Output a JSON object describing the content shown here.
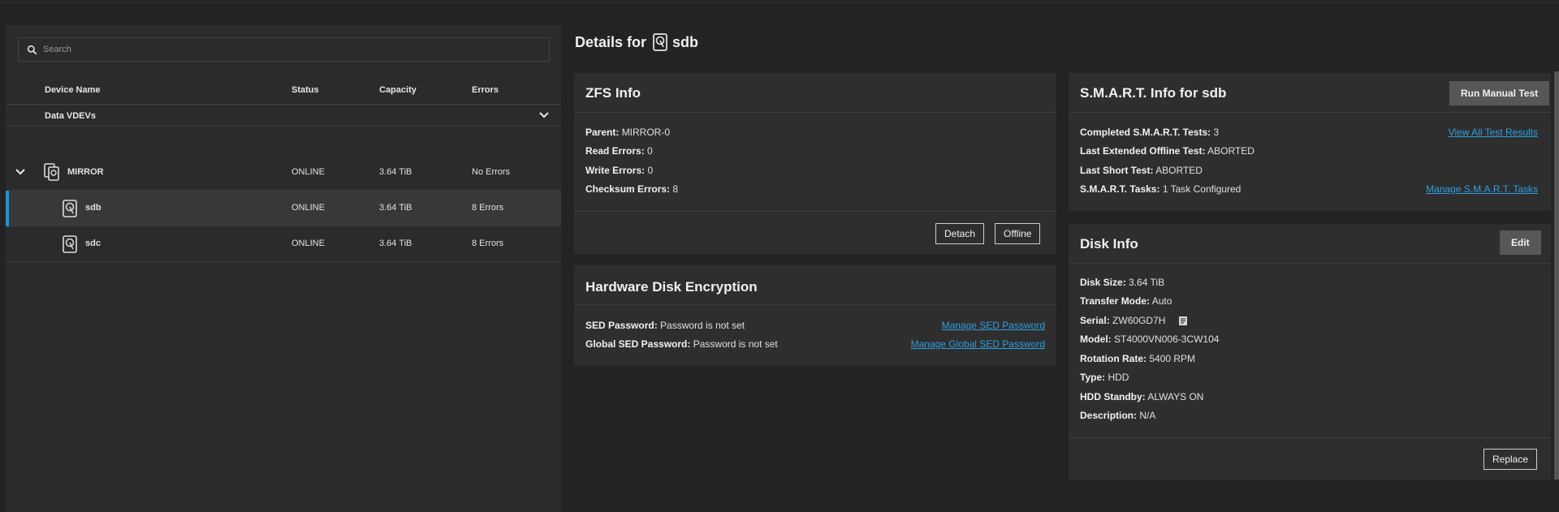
{
  "search": {
    "placeholder": "Search"
  },
  "table": {
    "headers": {
      "name": "Device Name",
      "status": "Status",
      "capacity": "Capacity",
      "errors": "Errors"
    },
    "group_label": "Data VDEVs",
    "rows": [
      {
        "name": "MIRROR",
        "status": "ONLINE",
        "capacity": "3.64 TiB",
        "errors": "No Errors"
      },
      {
        "name": "sdb",
        "status": "ONLINE",
        "capacity": "3.64 TiB",
        "errors": "8 Errors"
      },
      {
        "name": "sdc",
        "status": "ONLINE",
        "capacity": "3.64 TiB",
        "errors": "8 Errors"
      }
    ]
  },
  "details": {
    "prefix": "Details for",
    "disk": "sdb"
  },
  "zfs": {
    "title": "ZFS Info",
    "parent_label": "Parent:",
    "parent": "MIRROR-0",
    "read_label": "Read Errors:",
    "read": "0",
    "write_label": "Write Errors:",
    "write": "0",
    "checksum_label": "Checksum Errors:",
    "checksum": "8",
    "detach": "Detach",
    "offline": "Offline"
  },
  "hde": {
    "title": "Hardware Disk Encryption",
    "sed_label": "SED Password:",
    "sed": "Password is not set",
    "global_label": "Global SED Password:",
    "global": "Password is not set",
    "manage_sed": "Manage SED Password",
    "manage_global": "Manage Global SED Password"
  },
  "smart": {
    "title": "S.M.A.R.T. Info for sdb",
    "run_test": "Run Manual Test",
    "completed_label": "Completed S.M.A.R.T. Tests:",
    "completed": "3",
    "extended_label": "Last Extended Offline Test:",
    "extended": "ABORTED",
    "short_label": "Last Short Test:",
    "short": "ABORTED",
    "tasks_label": "S.M.A.R.T. Tasks:",
    "tasks": "1 Task Configured",
    "view_all": "View All Test Results",
    "manage_tasks": "Manage S.M.A.R.T. Tasks"
  },
  "disk_info": {
    "title": "Disk Info",
    "edit": "Edit",
    "size_label": "Disk Size:",
    "size": "3.64 TiB",
    "transfer_label": "Transfer Mode:",
    "transfer": "Auto",
    "serial_label": "Serial:",
    "serial": "ZW60GD7H",
    "model_label": "Model:",
    "model": "ST4000VN006-3CW104",
    "rotation_label": "Rotation Rate:",
    "rotation": "5400 RPM",
    "type_label": "Type:",
    "type": "HDD",
    "standby_label": "HDD Standby:",
    "standby": "ALWAYS ON",
    "desc_label": "Description:",
    "desc": "N/A",
    "replace": "Replace"
  },
  "colors": {
    "accent": "#1e96d6",
    "link": "#2e9fe0",
    "background": "#232323",
    "card": "#2e2e2e"
  },
  "icons": [
    "search-icon",
    "chevron-down-icon",
    "mirror-icon",
    "hard-disk-icon",
    "copy-icon"
  ]
}
